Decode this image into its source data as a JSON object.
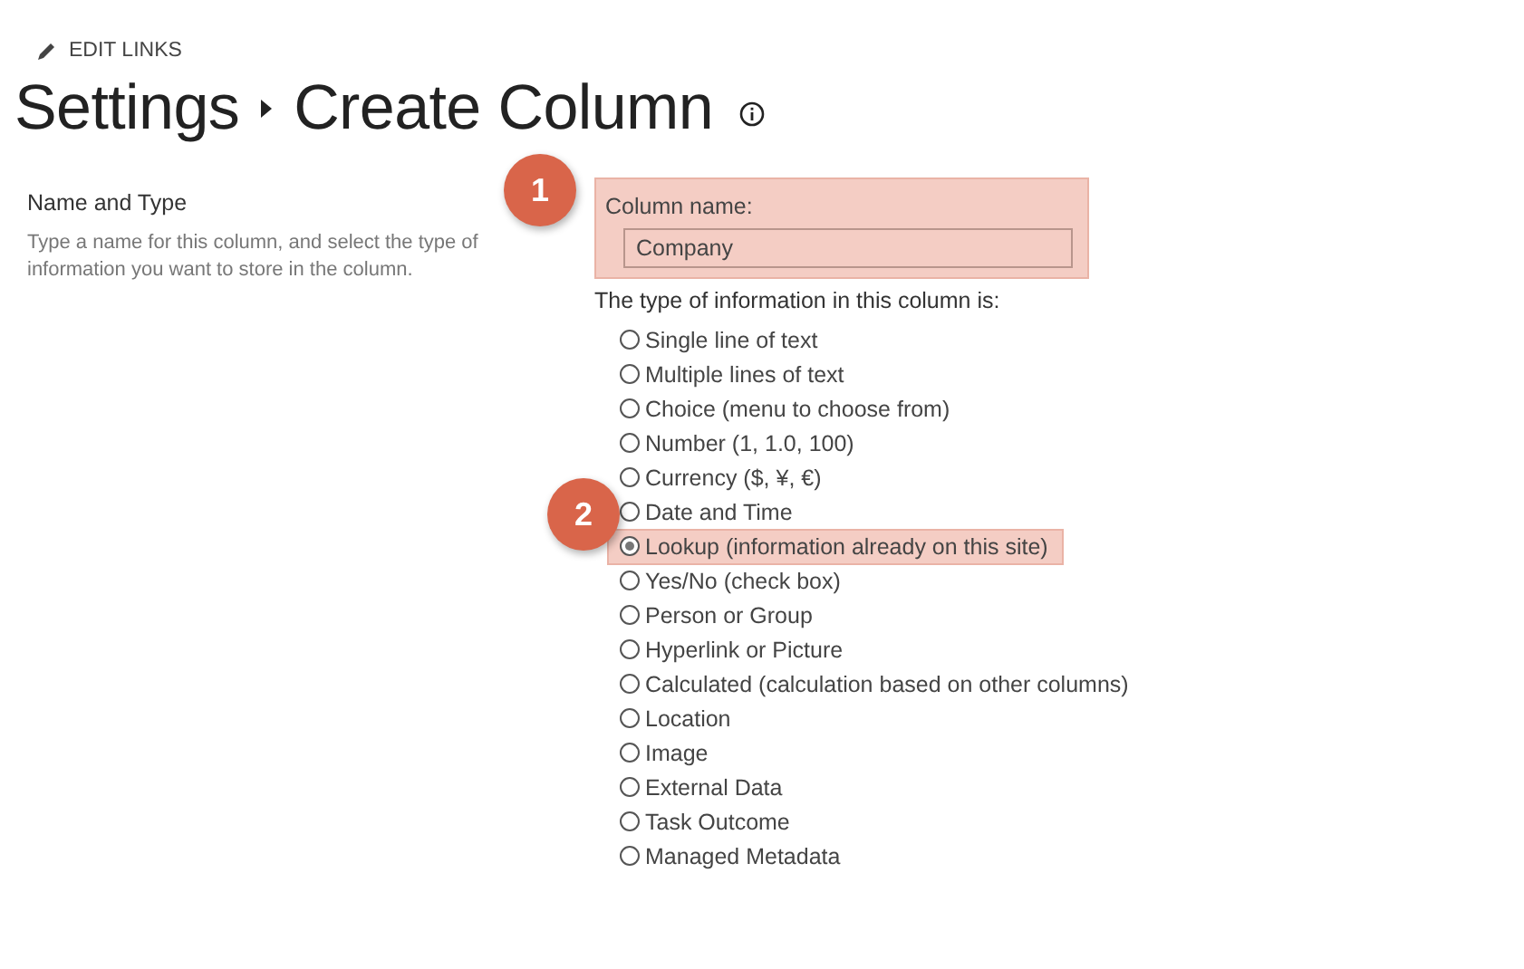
{
  "edit_links": {
    "label": "EDIT LINKS"
  },
  "breadcrumb": [
    {
      "label": "Settings"
    },
    {
      "label": "Create Column"
    }
  ],
  "section": {
    "title": "Name and Type",
    "description": "Type a name for this column, and select the type of information you want to store in the column."
  },
  "column_name": {
    "label": "Column name:",
    "value": "Company",
    "highlighted": true,
    "badge": "1"
  },
  "type_prompt": "The type of information in this column is:",
  "type_badge": "2",
  "types": [
    {
      "label": "Single line of text",
      "selected": false,
      "highlighted": false
    },
    {
      "label": "Multiple lines of text",
      "selected": false,
      "highlighted": false
    },
    {
      "label": "Choice (menu to choose from)",
      "selected": false,
      "highlighted": false
    },
    {
      "label": "Number (1, 1.0, 100)",
      "selected": false,
      "highlighted": false
    },
    {
      "label": "Currency ($, ¥, €)",
      "selected": false,
      "highlighted": false
    },
    {
      "label": "Date and Time",
      "selected": false,
      "highlighted": false
    },
    {
      "label": "Lookup (information already on this site)",
      "selected": true,
      "highlighted": true
    },
    {
      "label": "Yes/No (check box)",
      "selected": false,
      "highlighted": false
    },
    {
      "label": "Person or Group",
      "selected": false,
      "highlighted": false
    },
    {
      "label": "Hyperlink or Picture",
      "selected": false,
      "highlighted": false
    },
    {
      "label": "Calculated (calculation based on other columns)",
      "selected": false,
      "highlighted": false
    },
    {
      "label": "Location",
      "selected": false,
      "highlighted": false
    },
    {
      "label": "Image",
      "selected": false,
      "highlighted": false
    },
    {
      "label": "External Data",
      "selected": false,
      "highlighted": false
    },
    {
      "label": "Task Outcome",
      "selected": false,
      "highlighted": false
    },
    {
      "label": "Managed Metadata",
      "selected": false,
      "highlighted": false
    }
  ]
}
